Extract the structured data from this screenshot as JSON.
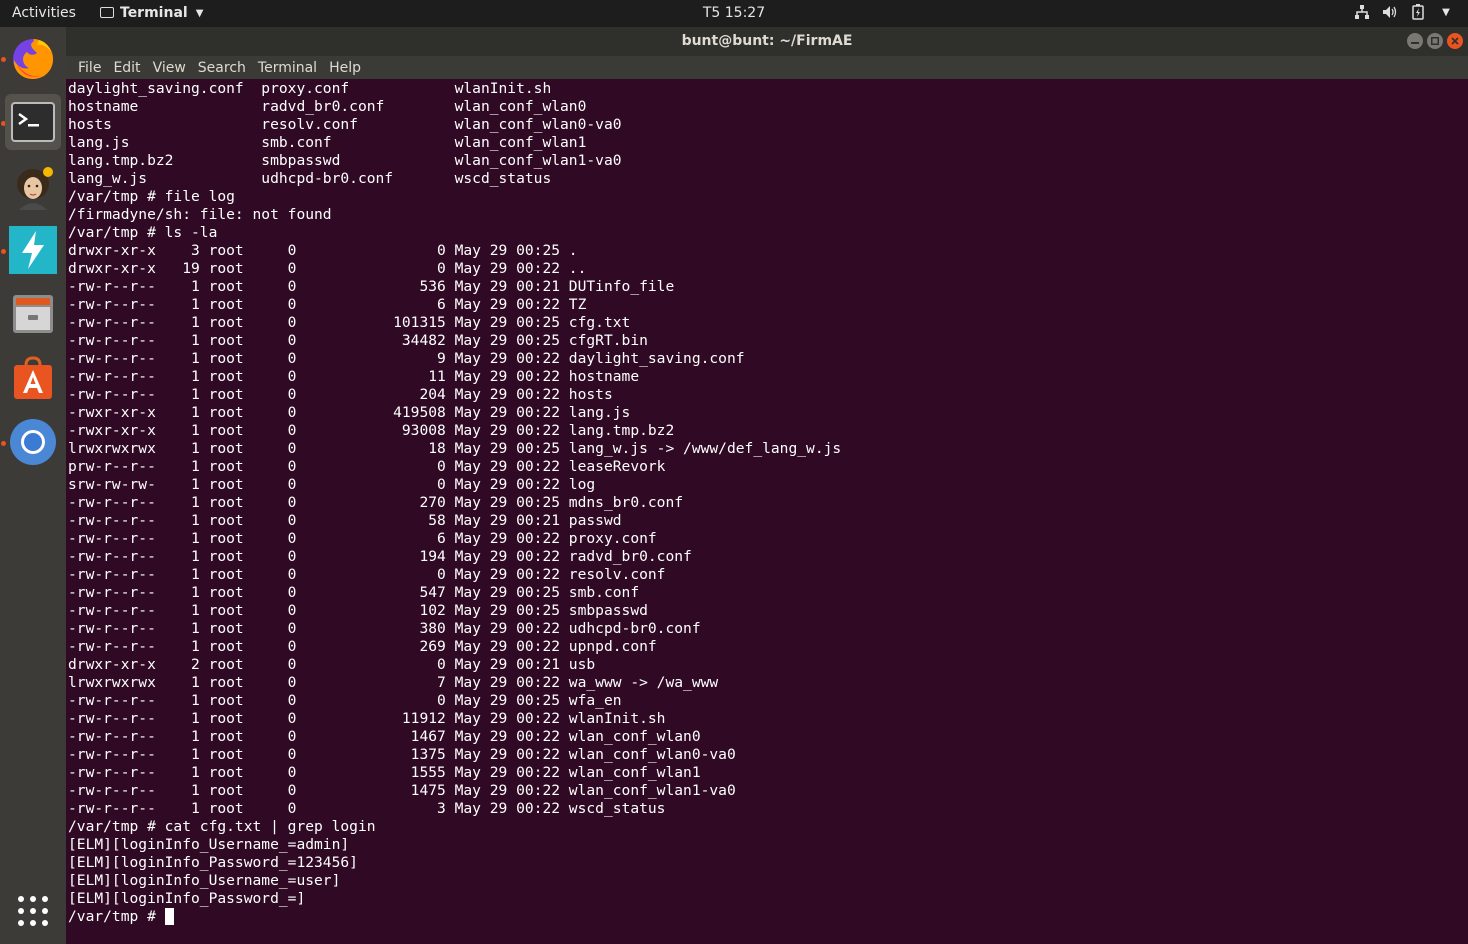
{
  "topbar": {
    "activities": "Activities",
    "app_name": "Terminal",
    "clock": "T5 15:27",
    "tray_icons": [
      "network-icon",
      "volume-icon",
      "battery-icon",
      "chevron-down-icon"
    ]
  },
  "dock": {
    "items": [
      {
        "name": "firefox",
        "icon": "firefox-icon",
        "running": true,
        "active": false
      },
      {
        "name": "terminal",
        "icon": "terminal-icon",
        "running": true,
        "active": true
      },
      {
        "name": "user-app",
        "icon": "portrait-icon",
        "running": false,
        "active": false
      },
      {
        "name": "flash-app",
        "icon": "lightning-icon",
        "running": true,
        "active": false
      },
      {
        "name": "files",
        "icon": "file-cabinet-icon",
        "running": false,
        "active": false
      },
      {
        "name": "software",
        "icon": "software-store-icon",
        "running": false,
        "active": false
      },
      {
        "name": "chromium",
        "icon": "chromium-icon",
        "running": true,
        "active": false
      }
    ],
    "show_apps_icon": "grid-icon"
  },
  "window": {
    "title": "bunt@bunt: ~/FirmAE"
  },
  "menubar": {
    "items": [
      "File",
      "Edit",
      "View",
      "Search",
      "Terminal",
      "Help"
    ]
  },
  "terminal": {
    "lines": [
      "daylight_saving.conf  proxy.conf            wlanInit.sh",
      "hostname              radvd_br0.conf        wlan_conf_wlan0",
      "hosts                 resolv.conf           wlan_conf_wlan0-va0",
      "lang.js               smb.conf              wlan_conf_wlan1",
      "lang.tmp.bz2          smbpasswd             wlan_conf_wlan1-va0",
      "lang_w.js             udhcpd-br0.conf       wscd_status",
      "/var/tmp # file log",
      "/firmadyne/sh: file: not found",
      "/var/tmp # ls -la",
      "drwxr-xr-x    3 root     0                0 May 29 00:25 .",
      "drwxr-xr-x   19 root     0                0 May 29 00:22 ..",
      "-rw-r--r--    1 root     0              536 May 29 00:21 DUTinfo_file",
      "-rw-r--r--    1 root     0                6 May 29 00:22 TZ",
      "-rw-r--r--    1 root     0           101315 May 29 00:25 cfg.txt",
      "-rw-r--r--    1 root     0            34482 May 29 00:25 cfgRT.bin",
      "-rw-r--r--    1 root     0                9 May 29 00:22 daylight_saving.conf",
      "-rw-r--r--    1 root     0               11 May 29 00:22 hostname",
      "-rw-r--r--    1 root     0              204 May 29 00:22 hosts",
      "-rwxr-xr-x    1 root     0           419508 May 29 00:22 lang.js",
      "-rwxr-xr-x    1 root     0            93008 May 29 00:22 lang.tmp.bz2",
      "lrwxrwxrwx    1 root     0               18 May 29 00:25 lang_w.js -> /www/def_lang_w.js",
      "prw-r--r--    1 root     0                0 May 29 00:22 leaseRevork",
      "srw-rw-rw-    1 root     0                0 May 29 00:22 log",
      "-rw-r--r--    1 root     0              270 May 29 00:25 mdns_br0.conf",
      "-rw-r--r--    1 root     0               58 May 29 00:21 passwd",
      "-rw-r--r--    1 root     0                6 May 29 00:22 proxy.conf",
      "-rw-r--r--    1 root     0              194 May 29 00:22 radvd_br0.conf",
      "-rw-r--r--    1 root     0                0 May 29 00:22 resolv.conf",
      "-rw-r--r--    1 root     0              547 May 29 00:25 smb.conf",
      "-rw-r--r--    1 root     0              102 May 29 00:25 smbpasswd",
      "-rw-r--r--    1 root     0              380 May 29 00:22 udhcpd-br0.conf",
      "-rw-r--r--    1 root     0              269 May 29 00:22 upnpd.conf",
      "drwxr-xr-x    2 root     0                0 May 29 00:21 usb",
      "lrwxrwxrwx    1 root     0                7 May 29 00:22 wa_www -> /wa_www",
      "-rw-r--r--    1 root     0                0 May 29 00:25 wfa_en",
      "-rw-r--r--    1 root     0            11912 May 29 00:22 wlanInit.sh",
      "-rw-r--r--    1 root     0             1467 May 29 00:22 wlan_conf_wlan0",
      "-rw-r--r--    1 root     0             1375 May 29 00:22 wlan_conf_wlan0-va0",
      "-rw-r--r--    1 root     0             1555 May 29 00:22 wlan_conf_wlan1",
      "-rw-r--r--    1 root     0             1475 May 29 00:22 wlan_conf_wlan1-va0",
      "-rw-r--r--    1 root     0                3 May 29 00:22 wscd_status",
      "/var/tmp # cat cfg.txt | grep login",
      "[ELM][loginInfo_Username_=admin]",
      "[ELM][loginInfo_Password_=123456]",
      "[ELM][loginInfo_Username_=user]",
      "[ELM][loginInfo_Password_=]"
    ],
    "prompt": "/var/tmp # "
  }
}
